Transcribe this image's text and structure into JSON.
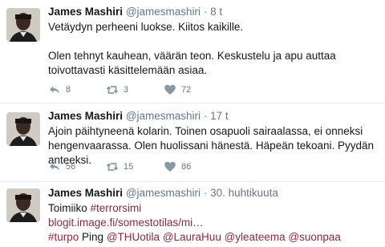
{
  "tweets": [
    {
      "fullname": "James Mashiri",
      "username": "@jamesmashiri",
      "separator": "·",
      "timestamp": "8 t",
      "paragraphs": [
        "Vetäydyn perheeni luokse. Kiitos kaikille.",
        "Olen tehnyt kauhean, väärän teon. Keskustelu ja apu auttaa toivottavasti käsittelemään asiaa."
      ],
      "reply_count": "8",
      "retweet_count": "3",
      "like_count": "72"
    },
    {
      "fullname": "James Mashiri",
      "username": "@jamesmashiri",
      "separator": "·",
      "timestamp": "17 t",
      "paragraphs": [
        "Ajoin päihtyneenä kolarin. Toinen osapuoli sairaalassa, ei onneksi hengenvaarassa. Olen huolissani hänestä. Häpeän tekoani. Pyydän anteeksi."
      ],
      "reply_count": "56",
      "retweet_count": "15",
      "like_count": "86"
    },
    {
      "fullname": "James Mashiri",
      "username": "@jamesmashiri",
      "separator": "·",
      "timestamp": "30. huhtikuuta",
      "line1_text": "Toimiiko",
      "line1_hashtag": "#terrorsimi",
      "link": "blogit.image.fi/somestotilas/mi…",
      "hashtag_turpo": "#turpo",
      "ping_text": "Ping",
      "mentions": [
        "@THUotila",
        "@LauraHuu",
        "@yleateema",
        "@suonpaa"
      ]
    }
  ],
  "icons": {
    "reply": "reply-icon",
    "retweet": "retweet-icon",
    "like": "heart-icon"
  },
  "colors": {
    "text": "#14171a",
    "muted": "#657786",
    "link": "#1b95e0",
    "hashtag": "#8c2846",
    "divider": "#e6ecf0"
  }
}
